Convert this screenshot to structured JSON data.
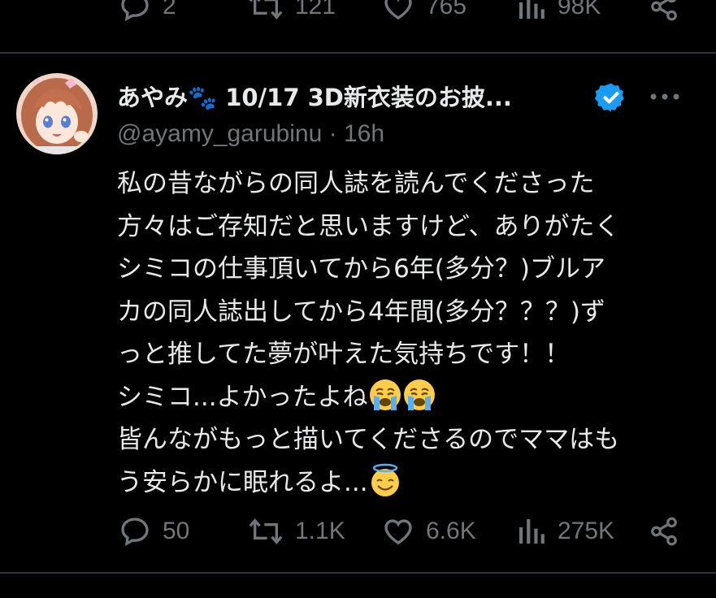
{
  "previous_tweet": {
    "actions": {
      "replies": "2",
      "reposts": "121",
      "likes": "765",
      "views": "98K"
    }
  },
  "tweet": {
    "display_name": "あやみ🐾 10/17 3D新衣装のお披...",
    "handle": "@ayamy_garubinu",
    "separator": "·",
    "time": "16h",
    "body_lines": [
      "私の昔ながらの同人誌を読んでくださった",
      "方々はご存知だと思いますけど、ありがたく",
      "シミコの仕事頂いてから6年(多分？)ブルア",
      "カの同人誌出してから4年間(多分？？？)ず",
      "っと推してた夢が叶えた気持ちです！！",
      "シミコ...よかったよね",
      "皆んながもっと描いてくださるのでママはも",
      "う安らかに眠れるよ..."
    ],
    "actions": {
      "replies": "50",
      "reposts": "1.1K",
      "likes": "6.6K",
      "views": "275K"
    }
  },
  "colors": {
    "background": "#000000",
    "text": "#e7e9ea",
    "muted": "#71767b",
    "divider": "#2f3336",
    "verified": "#1d9bf0"
  },
  "icons": [
    "reply-icon",
    "repost-icon",
    "like-icon",
    "views-icon",
    "share-icon",
    "verified-badge-icon",
    "more-options-icon",
    "crying-face-emoji",
    "halo-smile-emoji"
  ]
}
